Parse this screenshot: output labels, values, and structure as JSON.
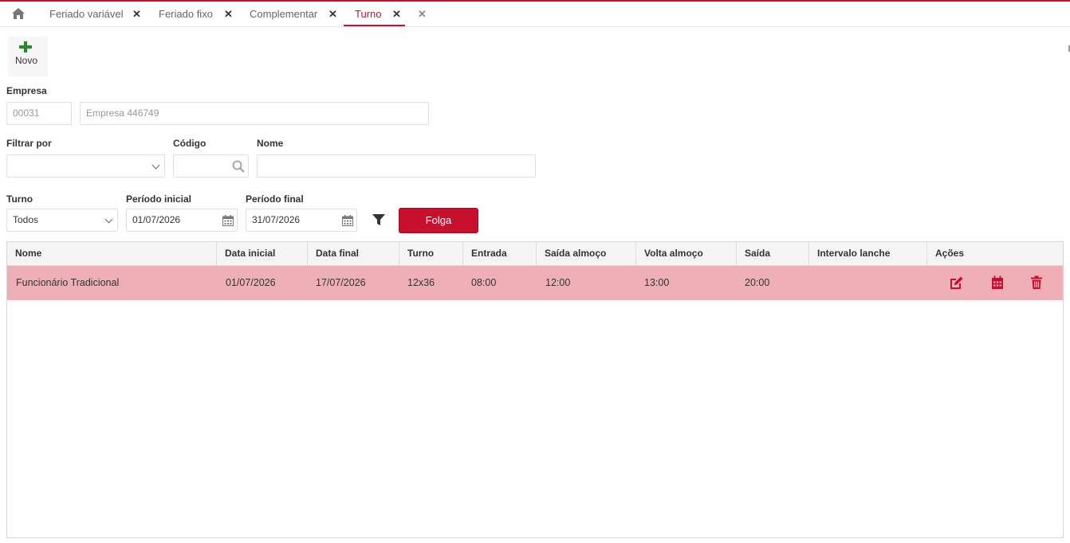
{
  "tabs": [
    {
      "label": "Feriado variável",
      "close": "✕"
    },
    {
      "label": "Feriado fixo",
      "close": "✕"
    },
    {
      "label": "Complementar",
      "close": "✕"
    },
    {
      "label": "Turno",
      "close": "✕",
      "active": true
    }
  ],
  "extra_close": "✕",
  "toolbar": {
    "novo_label": "Novo"
  },
  "empresa": {
    "label": "Empresa",
    "code": "00031",
    "name": "Empresa 446749"
  },
  "filters": {
    "filtrar_por_label": "Filtrar por",
    "filtrar_por_value": "",
    "codigo_label": "Código",
    "codigo_value": "",
    "nome_label": "Nome",
    "nome_value": ""
  },
  "period": {
    "turno_label": "Turno",
    "turno_value": "Todos",
    "inicial_label": "Período inicial",
    "inicial_value": "01/07/2026",
    "final_label": "Período final",
    "final_value": "31/07/2026",
    "folga_label": "Folga"
  },
  "table": {
    "headers": [
      "Nome",
      "Data inicial",
      "Data final",
      "Turno",
      "Entrada",
      "Saída almoço",
      "Volta almoço",
      "Saída",
      "Intervalo lanche",
      "Ações"
    ],
    "rows": [
      {
        "nome": "Funcionário Tradicional",
        "data_inicial": "01/07/2026",
        "data_final": "17/07/2026",
        "turno": "12x36",
        "entrada": "08:00",
        "saida_almoco": "12:00",
        "volta_almoco": "13:00",
        "saida": "20:00",
        "intervalo_lanche": ""
      }
    ]
  },
  "colors": {
    "accent": "#c8102e",
    "row_highlight": "#efafb7",
    "add_green": "#2b8a2b"
  },
  "icons": [
    "home-icon",
    "plus-icon",
    "chevron-down-icon",
    "search-icon",
    "calendar-icon",
    "filter-icon",
    "edit-icon",
    "calendar-icon",
    "trash-icon"
  ]
}
